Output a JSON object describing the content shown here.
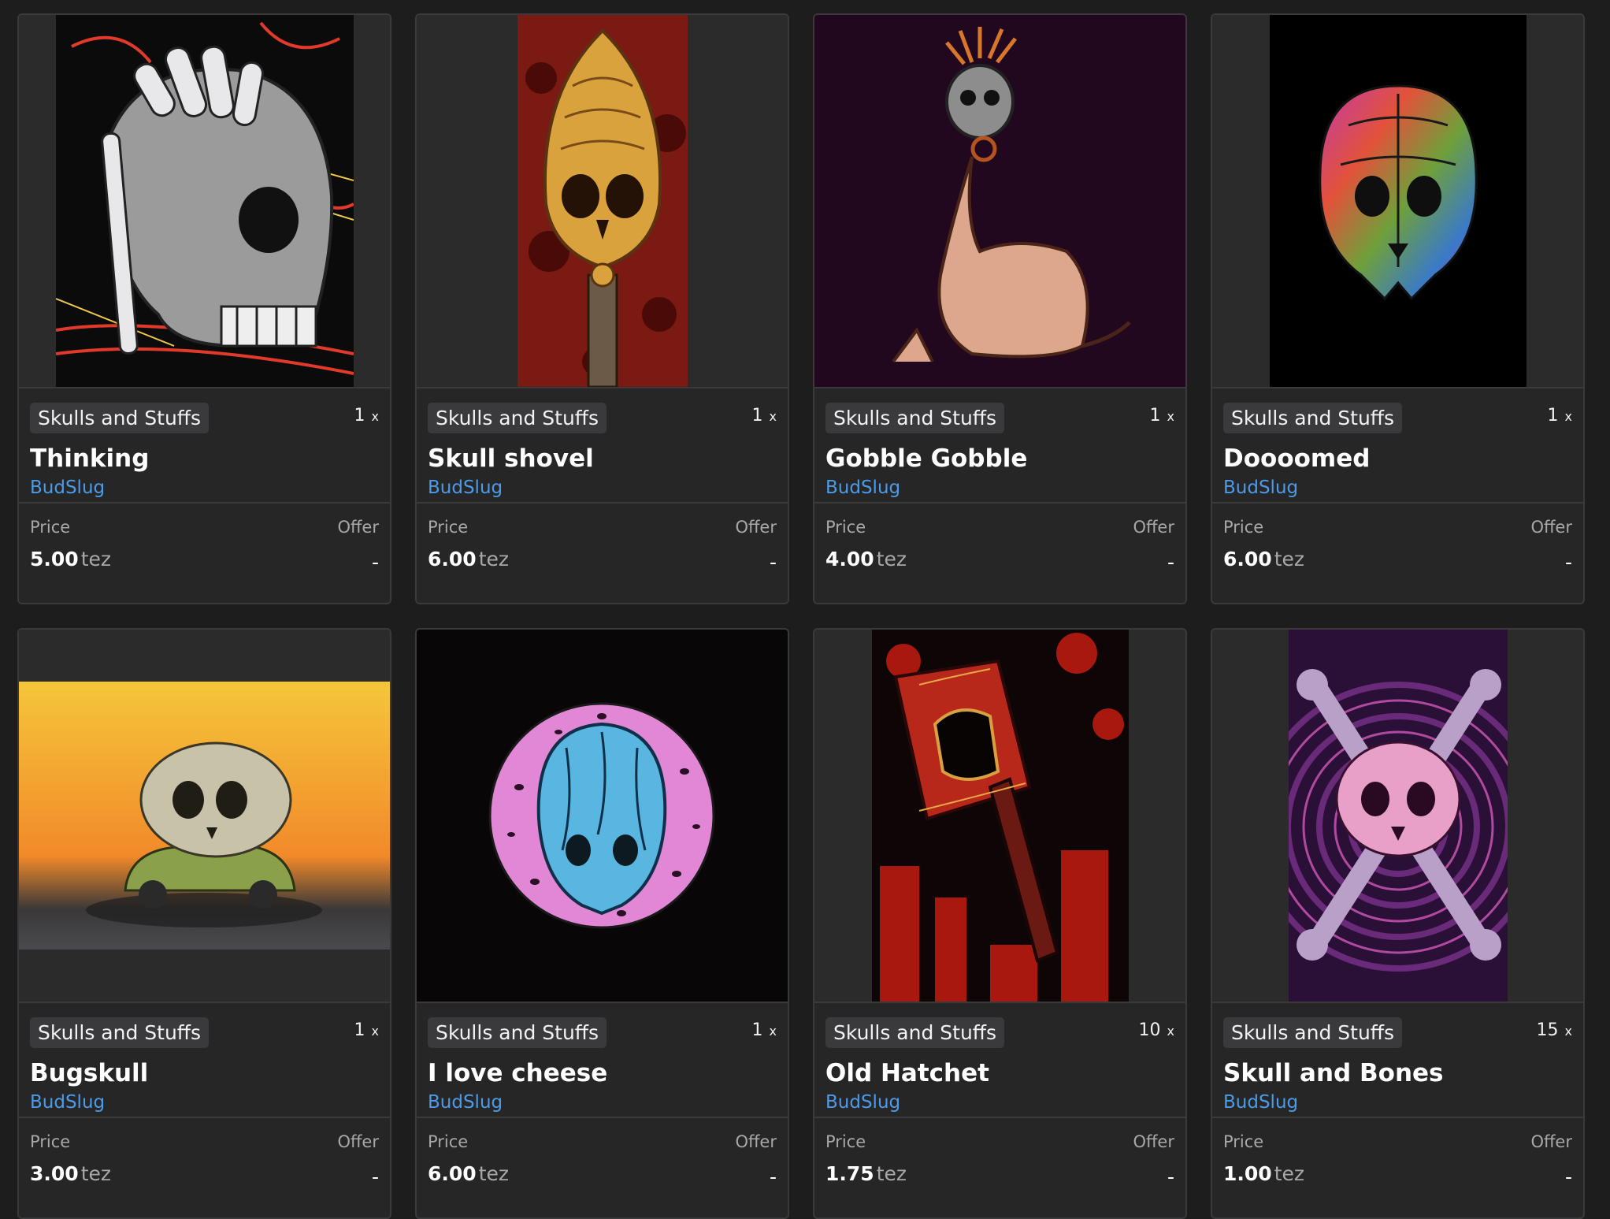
{
  "labels": {
    "price": "Price",
    "offer": "Offer",
    "unit": "tez",
    "multiplier": "x"
  },
  "cards": [
    {
      "collection": "Skulls and Stuffs",
      "edition": "1",
      "title": "Thinking",
      "artist": "BudSlug",
      "price": "5.00",
      "offer": "-"
    },
    {
      "collection": "Skulls and Stuffs",
      "edition": "1",
      "title": "Skull shovel",
      "artist": "BudSlug",
      "price": "6.00",
      "offer": "-"
    },
    {
      "collection": "Skulls and Stuffs",
      "edition": "1",
      "title": "Gobble Gobble",
      "artist": "BudSlug",
      "price": "4.00",
      "offer": "-"
    },
    {
      "collection": "Skulls and Stuffs",
      "edition": "1",
      "title": "Doooomed",
      "artist": "BudSlug",
      "price": "6.00",
      "offer": "-"
    },
    {
      "collection": "Skulls and Stuffs",
      "edition": "1",
      "title": "Bugskull",
      "artist": "BudSlug",
      "price": "3.00",
      "offer": "-"
    },
    {
      "collection": "Skulls and Stuffs",
      "edition": "1",
      "title": "I love cheese",
      "artist": "BudSlug",
      "price": "6.00",
      "offer": "-"
    },
    {
      "collection": "Skulls and Stuffs",
      "edition": "10",
      "title": "Old Hatchet",
      "artist": "BudSlug",
      "price": "1.75",
      "offer": "-"
    },
    {
      "collection": "Skulls and Stuffs",
      "edition": "15",
      "title": "Skull and Bones",
      "artist": "BudSlug",
      "price": "1.00",
      "offer": "-"
    }
  ]
}
